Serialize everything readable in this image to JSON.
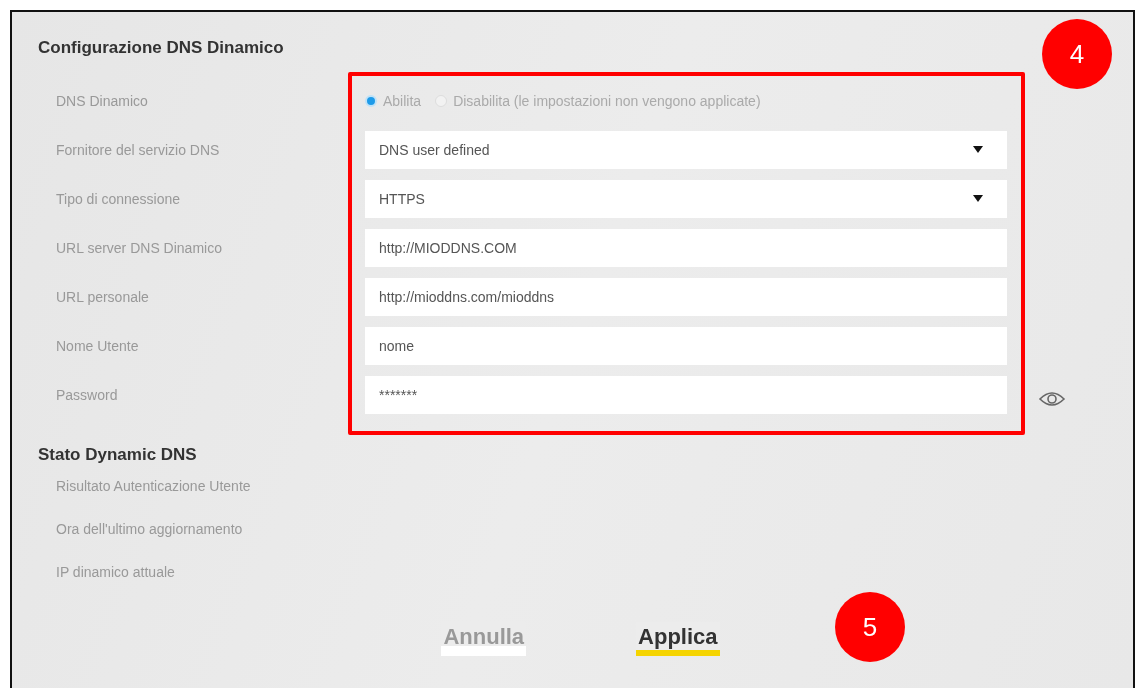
{
  "section_title": "Configurazione DNS Dinamico",
  "fields": [
    {
      "label": "DNS Dinamico",
      "kind": "radio",
      "options": [
        {
          "label": "Abilita",
          "selected": true
        },
        {
          "label": "Disabilita (le impostazioni non vengono applicate)",
          "selected": false
        }
      ]
    },
    {
      "label": "Fornitore del servizio DNS",
      "kind": "select",
      "value": "DNS user defined"
    },
    {
      "label": "Tipo di connessione",
      "kind": "select",
      "value": "HTTPS"
    },
    {
      "label": "URL server DNS Dinamico",
      "kind": "text",
      "value": "http://MIODDNS.COM"
    },
    {
      "label": "URL personale",
      "kind": "text",
      "value": "http://mioddns.com/mioddns"
    },
    {
      "label": "Nome Utente",
      "kind": "text",
      "value": "nome"
    },
    {
      "label": "Password",
      "kind": "password",
      "value": "*******"
    }
  ],
  "status": {
    "title": "Stato Dynamic DNS",
    "items": [
      "Risultato Autenticazione Utente",
      "Ora dell'ultimo aggiornamento",
      "IP dinamico attuale"
    ]
  },
  "buttons": [
    {
      "label": "Annulla",
      "kind": "secondary"
    },
    {
      "label": "Applica",
      "kind": "primary"
    }
  ],
  "annotations": [
    {
      "label": "4"
    },
    {
      "label": "5"
    }
  ]
}
